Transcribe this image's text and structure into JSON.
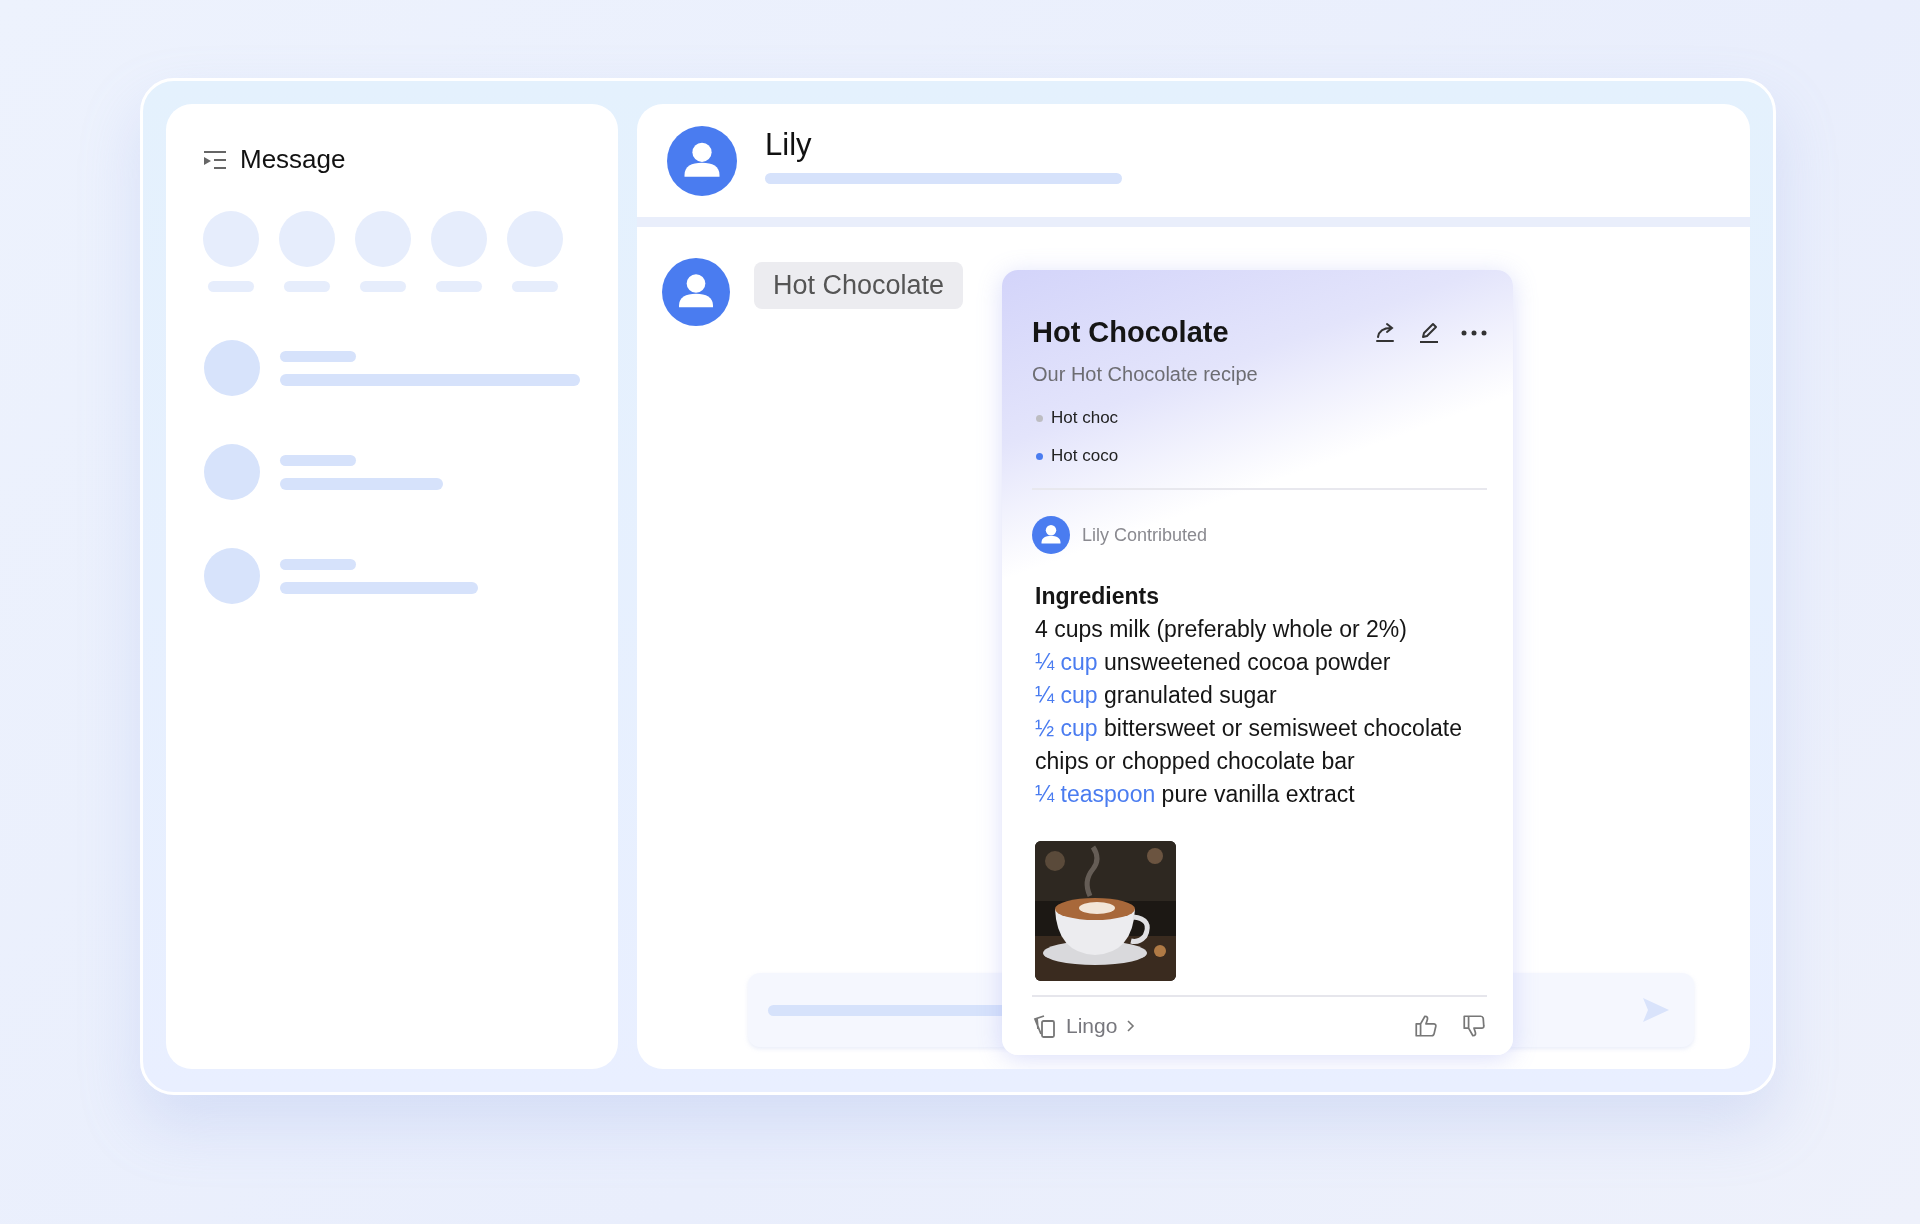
{
  "sidebar": {
    "title": "Message"
  },
  "chat_header": {
    "name": "Lily"
  },
  "messages": [
    {
      "kind": "query",
      "text": "Hot Chocolate"
    }
  ],
  "card": {
    "title": "Hot Chocolate",
    "subtitle": "Our Hot Chocolate recipe",
    "tags": [
      {
        "label": "Hot choc",
        "color": "#bdbdc2"
      },
      {
        "label": "Hot coco",
        "color": "#4a7cf0"
      }
    ],
    "contributor": "Lily Contributed",
    "heading": "Ingredients",
    "lines": [
      {
        "text": "4 cups milk (preferably whole or 2%)"
      },
      {
        "amount": "¼ cup",
        "text": "unsweetened cocoa powder"
      },
      {
        "amount": "¼ cup",
        "text": "granulated sugar"
      },
      {
        "amount": "½ cup",
        "text": "bittersweet or semisweet chocolate chips or chopped chocolate bar"
      },
      {
        "amount": "¼ teaspoon",
        "text": "pure vanilla extract"
      }
    ],
    "source": "Lingo"
  }
}
